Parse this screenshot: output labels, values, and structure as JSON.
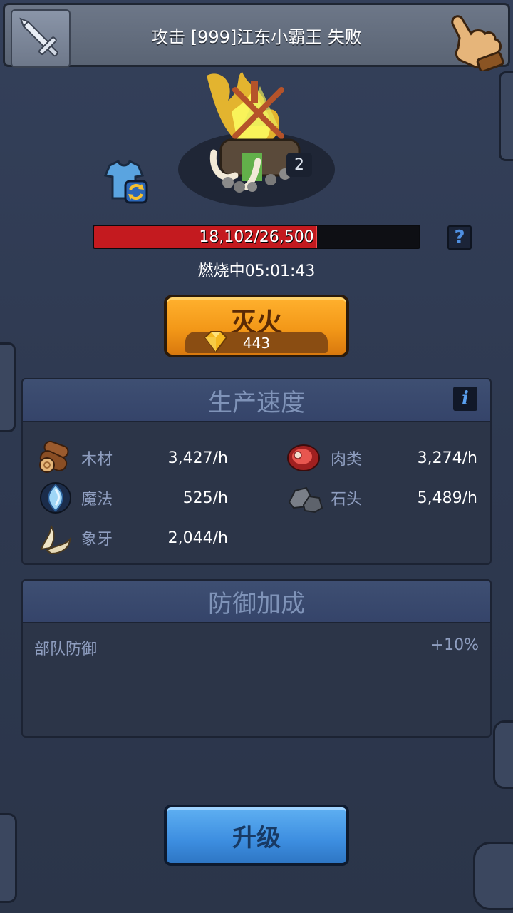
{
  "notification": {
    "text": "攻击 [999]江东小霸王 失败",
    "left_icon": "sword-attack-icon",
    "right_icon": "pointing-hand-icon"
  },
  "building": {
    "level": "2",
    "icon": "campfire-icon"
  },
  "hp": {
    "text": "18,102/26,500",
    "current": 18102,
    "max": 26500,
    "help_label": "?"
  },
  "status": {
    "burning_text": "燃烧中05:01:43"
  },
  "extinguish_button": {
    "label": "灭火",
    "cost": "443",
    "cost_icon": "gem-icon"
  },
  "production": {
    "title": "生产速度",
    "info_label": "i",
    "resources": [
      {
        "name": "木材",
        "value": "3,427/h",
        "icon": "wood-log-icon"
      },
      {
        "name": "肉类",
        "value": "3,274/h",
        "icon": "meat-icon"
      },
      {
        "name": "魔法",
        "value": "525/h",
        "icon": "magic-crystal-icon"
      },
      {
        "name": "石头",
        "value": "5,489/h",
        "icon": "stone-icon"
      },
      {
        "name": "象牙",
        "value": "2,044/h",
        "icon": "ivory-tusk-icon"
      }
    ]
  },
  "defense": {
    "title": "防御加成",
    "rows": [
      {
        "label": "部队防御",
        "value": "+10%"
      }
    ]
  },
  "upgrade_button": {
    "label": "升级"
  },
  "colors": {
    "background": "#2f3a4f",
    "hp_fill": "#c41a1f",
    "orange_button": "#f39818",
    "blue_button": "#3d8ee0",
    "panel_header": "#3e4f72",
    "label_text": "#8f9ec0"
  }
}
